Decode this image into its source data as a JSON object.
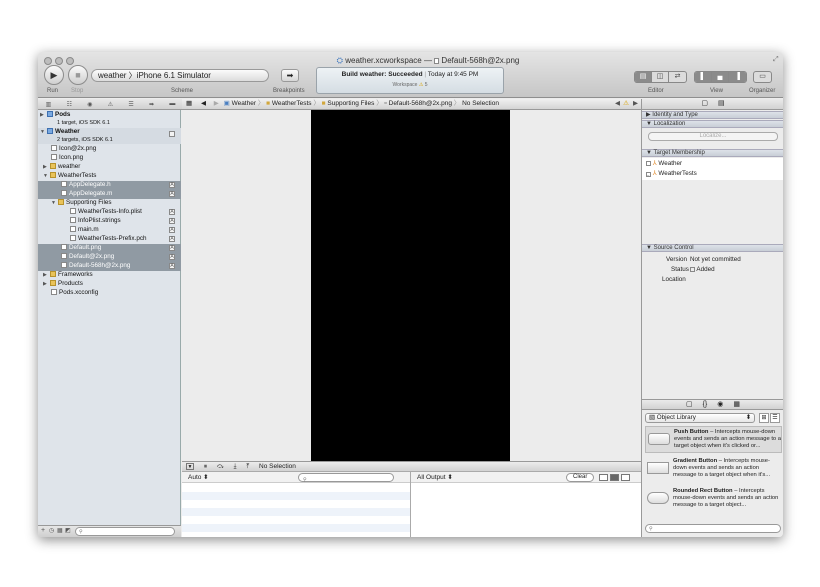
{
  "title": {
    "text": "weather.xcworkspace — ",
    "file": "Default-568h@2x.png"
  },
  "toolbar": {
    "run": "Run",
    "stop": "Stop",
    "scheme_label": "Scheme",
    "breakpoints": "Breakpoints",
    "editor": "Editor",
    "view": "View",
    "organizer": "Organizer",
    "scheme_value": "weather  〉iPhone 6.1 Simulator"
  },
  "activity": {
    "status": "Build weather: Succeeded",
    "time": "Today at 9:45 PM",
    "sub": "Workspace",
    "warn": "5"
  },
  "navigator": {
    "rows": [
      {
        "label": "Pods",
        "sub": "1 target, iOS SDK 6.1"
      },
      {
        "label": "Weather",
        "sub": "2 targets, iOS SDK 6.1"
      },
      {
        "label": "Icon@2x.png"
      },
      {
        "label": "Icon.png"
      },
      {
        "label": "weather"
      },
      {
        "label": "WeatherTests"
      },
      {
        "label": "AppDelegate.h",
        "badge": "A"
      },
      {
        "label": "AppDelegate.m",
        "badge": "A"
      },
      {
        "label": "Supporting Files"
      },
      {
        "label": "WeatherTests-Info.plist",
        "badge": "A"
      },
      {
        "label": "InfoPlist.strings",
        "badge": "A"
      },
      {
        "label": "main.m",
        "badge": "A"
      },
      {
        "label": "WeatherTests-Prefix.pch",
        "badge": "A"
      },
      {
        "label": "Default.png",
        "badge": "A"
      },
      {
        "label": "Default@2x.png",
        "badge": "A"
      },
      {
        "label": "Default-568h@2x.png",
        "badge": "A"
      },
      {
        "label": "Frameworks"
      },
      {
        "label": "Products"
      },
      {
        "label": "Pods.xcconfig"
      }
    ]
  },
  "jumpbar": {
    "c1": "Weather",
    "c2": "WeatherTests",
    "c3": "Supporting Files",
    "c4": "Default-568h@2x.png",
    "c5": "No Selection"
  },
  "debug": {
    "selection": "No Selection",
    "auto": "Auto ⬍",
    "all_output": "All Output ⬍",
    "clear": "Clear"
  },
  "inspector": {
    "identity": "Identity and Type",
    "localization": "Localization",
    "localize": "Localize...",
    "membership": "Target Membership",
    "t1": "Weather",
    "t2": "WeatherTests",
    "source": "Source Control",
    "version_label": "Version",
    "version_value": "Not yet committed",
    "status_label": "Status",
    "status_value": "Added",
    "location_label": "Location"
  },
  "library": {
    "selector": "Object Library",
    "items": [
      {
        "name": "Push Button",
        "desc": " – Intercepts mouse-down events and sends an action message to a target object when it's clicked or..."
      },
      {
        "name": "Gradient Button",
        "desc": " – Intercepts mouse-down events and sends an action message to a target object when it's..."
      },
      {
        "name": "Rounded Rect Button",
        "desc": " – Intercepts mouse-down events and sends an action message to a target object..."
      }
    ]
  }
}
